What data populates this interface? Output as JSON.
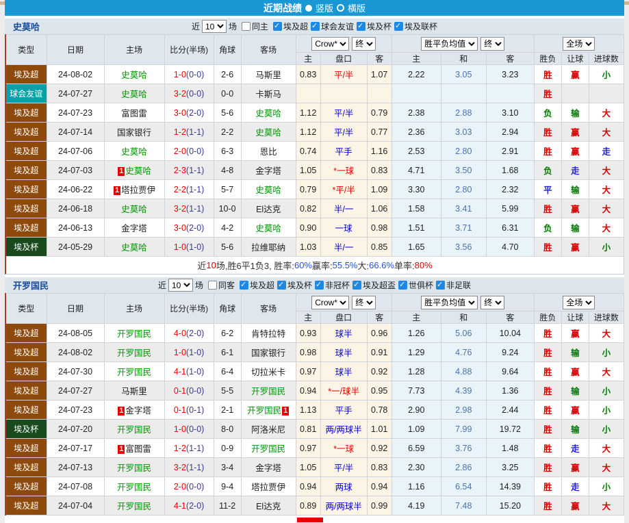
{
  "title_bar": {
    "title": "近期战绩",
    "radio_vertical": "竖版",
    "radio_horizontal": "横版"
  },
  "colors": {
    "accent_blue": "#1a97d5",
    "league_brown": "#8d4a0b",
    "friendly_teal": "#07a2a8",
    "cup_green": "#184a1d",
    "team_green": "#009900"
  },
  "card_badge": "1",
  "columns": {
    "type": "类型",
    "date": "日期",
    "home": "主场",
    "score": "比分(半场)",
    "corner": "角球",
    "away": "客场",
    "h": "主",
    "handicap": "盘口",
    "a": "客",
    "w": "主",
    "d": "和",
    "l": "客",
    "result": "胜负",
    "cover": "让球",
    "goals": "进球数",
    "odds_select": "Crow*",
    "final_select": "终",
    "avg_select": "胜平负均值",
    "scope_select": "全场"
  },
  "sections": [
    {
      "team": "史莫哈",
      "filters": {
        "near_label": "近",
        "count": "10",
        "games_label": "场",
        "same_label": "同主",
        "leagues": [
          "埃及超",
          "球会友谊",
          "埃及杯",
          "埃及联杯"
        ]
      },
      "rows": [
        {
          "lg": "埃及超",
          "lgc": "b",
          "dt": "24-08-02",
          "hm": "史莫哈",
          "hmg": true,
          "hc": false,
          "sc": "1-0",
          "hf": "(0-0)",
          "cn": "2-6",
          "aw": "马斯里",
          "awg": false,
          "ac": false,
          "o1": "0.83",
          "hd": "平/半",
          "hdr": true,
          "o2": "1.07",
          "w": "2.22",
          "d": "3.05",
          "l": "3.23",
          "rs": "胜",
          "cv": "赢",
          "gl": "小"
        },
        {
          "lg": "球会友谊",
          "lgc": "t",
          "dt": "24-07-27",
          "hm": "史莫哈",
          "hmg": true,
          "hc": false,
          "sc": "3-2",
          "hf": "(0-0)",
          "cn": "0-0",
          "aw": "卡斯马",
          "awg": false,
          "ac": false,
          "o1": "",
          "hd": "",
          "hdr": false,
          "o2": "",
          "w": "",
          "d": "",
          "l": "",
          "rs": "胜",
          "cv": "",
          "gl": ""
        },
        {
          "lg": "埃及超",
          "lgc": "b",
          "dt": "24-07-23",
          "hm": "富图雷",
          "hmg": false,
          "hc": false,
          "sc": "3-0",
          "hf": "(2-0)",
          "cn": "5-6",
          "aw": "史莫哈",
          "awg": true,
          "ac": false,
          "o1": "1.12",
          "hd": "平/半",
          "hdr": false,
          "o2": "0.79",
          "w": "2.38",
          "d": "2.88",
          "l": "3.10",
          "rs": "负",
          "cv": "输",
          "gl": "大"
        },
        {
          "lg": "埃及超",
          "lgc": "b",
          "dt": "24-07-14",
          "hm": "国家银行",
          "hmg": false,
          "hc": false,
          "sc": "1-2",
          "hf": "(1-1)",
          "cn": "2-2",
          "aw": "史莫哈",
          "awg": true,
          "ac": false,
          "o1": "1.12",
          "hd": "平/半",
          "hdr": false,
          "o2": "0.77",
          "w": "2.36",
          "d": "3.03",
          "l": "2.94",
          "rs": "胜",
          "cv": "赢",
          "gl": "大"
        },
        {
          "lg": "埃及超",
          "lgc": "b",
          "dt": "24-07-06",
          "hm": "史莫哈",
          "hmg": true,
          "hc": false,
          "sc": "2-0",
          "hf": "(0-0)",
          "cn": "6-3",
          "aw": "恩比",
          "awg": false,
          "ac": false,
          "o1": "0.74",
          "hd": "平手",
          "hdr": false,
          "o2": "1.16",
          "w": "2.53",
          "d": "2.80",
          "l": "2.91",
          "rs": "胜",
          "cv": "赢",
          "gl": "走"
        },
        {
          "lg": "埃及超",
          "lgc": "b",
          "dt": "24-07-03",
          "hm": "史莫哈",
          "hmg": true,
          "hc": true,
          "sc": "2-3",
          "hf": "(1-1)",
          "cn": "4-8",
          "aw": "金字塔",
          "awg": false,
          "ac": false,
          "o1": "1.05",
          "hd": "*一球",
          "hdr": true,
          "o2": "0.83",
          "w": "4.71",
          "d": "3.50",
          "l": "1.68",
          "rs": "负",
          "cv": "走",
          "gl": "大"
        },
        {
          "lg": "埃及超",
          "lgc": "b",
          "dt": "24-06-22",
          "hm": "塔拉贾伊",
          "hmg": false,
          "hc": true,
          "sc": "2-2",
          "hf": "(1-1)",
          "cn": "5-7",
          "aw": "史莫哈",
          "awg": true,
          "ac": false,
          "o1": "0.79",
          "hd": "*平/半",
          "hdr": true,
          "o2": "1.09",
          "w": "3.30",
          "d": "2.80",
          "l": "2.32",
          "rs": "平",
          "cv": "输",
          "gl": "大"
        },
        {
          "lg": "埃及超",
          "lgc": "b",
          "dt": "24-06-18",
          "hm": "史莫哈",
          "hmg": true,
          "hc": false,
          "sc": "3-2",
          "hf": "(1-1)",
          "cn": "10-0",
          "aw": "El达克",
          "awg": false,
          "ac": false,
          "o1": "0.82",
          "hd": "半/一",
          "hdr": false,
          "o2": "1.06",
          "w": "1.58",
          "d": "3.41",
          "l": "5.99",
          "rs": "胜",
          "cv": "赢",
          "gl": "大"
        },
        {
          "lg": "埃及超",
          "lgc": "b",
          "dt": "24-06-13",
          "hm": "金字塔",
          "hmg": false,
          "hc": false,
          "sc": "3-0",
          "hf": "(2-0)",
          "cn": "4-2",
          "aw": "史莫哈",
          "awg": true,
          "ac": false,
          "o1": "0.90",
          "hd": "一球",
          "hdr": false,
          "o2": "0.98",
          "w": "1.51",
          "d": "3.71",
          "l": "6.31",
          "rs": "负",
          "cv": "输",
          "gl": "大"
        },
        {
          "lg": "埃及杯",
          "lgc": "g",
          "dt": "24-05-29",
          "hm": "史莫哈",
          "hmg": true,
          "hc": false,
          "sc": "1-0",
          "hf": "(1-0)",
          "cn": "5-6",
          "aw": "拉维耶纳",
          "awg": false,
          "ac": false,
          "o1": "1.03",
          "hd": "半/一",
          "hdr": false,
          "o2": "0.85",
          "w": "1.65",
          "d": "3.56",
          "l": "4.70",
          "rs": "胜",
          "cv": "赢",
          "gl": "小"
        }
      ],
      "summary_parts": [
        {
          "t": "近",
          "c": "k"
        },
        {
          "t": "10",
          "c": "r"
        },
        {
          "t": "场,胜6平1负3, 胜率:",
          "c": "k"
        },
        {
          "t": "60%",
          "c": "b"
        },
        {
          "t": " 赢率:",
          "c": "k"
        },
        {
          "t": "55.5%",
          "c": "b"
        },
        {
          "t": " 大:",
          "c": "k"
        },
        {
          "t": "66.6%",
          "c": "b"
        },
        {
          "t": " 单率:",
          "c": "k"
        },
        {
          "t": "80%",
          "c": "r"
        }
      ]
    },
    {
      "team": "开罗国民",
      "filters": {
        "near_label": "近",
        "count": "10",
        "games_label": "场",
        "same_label": "同客",
        "leagues": [
          "埃及超",
          "埃及杯",
          "非冠杯",
          "埃及超盃",
          "世俱杯",
          "非足联"
        ]
      },
      "rows": [
        {
          "lg": "埃及超",
          "lgc": "b",
          "dt": "24-08-05",
          "hm": "开罗国民",
          "hmg": true,
          "hc": false,
          "sc": "4-0",
          "hf": "(2-0)",
          "cn": "6-2",
          "aw": "肯特拉特",
          "awg": false,
          "ac": false,
          "o1": "0.93",
          "hd": "球半",
          "hdr": false,
          "o2": "0.96",
          "w": "1.26",
          "d": "5.06",
          "l": "10.04",
          "rs": "胜",
          "cv": "赢",
          "gl": "大"
        },
        {
          "lg": "埃及超",
          "lgc": "b",
          "dt": "24-08-02",
          "hm": "开罗国民",
          "hmg": true,
          "hc": false,
          "sc": "1-0",
          "hf": "(1-0)",
          "cn": "6-1",
          "aw": "国家银行",
          "awg": false,
          "ac": false,
          "o1": "0.98",
          "hd": "球半",
          "hdr": false,
          "o2": "0.91",
          "w": "1.29",
          "d": "4.76",
          "l": "9.24",
          "rs": "胜",
          "cv": "输",
          "gl": "小"
        },
        {
          "lg": "埃及超",
          "lgc": "b",
          "dt": "24-07-30",
          "hm": "开罗国民",
          "hmg": true,
          "hc": false,
          "sc": "4-1",
          "hf": "(1-0)",
          "cn": "6-4",
          "aw": "切拉米卡",
          "awg": false,
          "ac": false,
          "o1": "0.97",
          "hd": "球半",
          "hdr": false,
          "o2": "0.92",
          "w": "1.28",
          "d": "4.88",
          "l": "9.64",
          "rs": "胜",
          "cv": "赢",
          "gl": "大"
        },
        {
          "lg": "埃及超",
          "lgc": "b",
          "dt": "24-07-27",
          "hm": "马斯里",
          "hmg": false,
          "hc": false,
          "sc": "0-1",
          "hf": "(0-0)",
          "cn": "5-5",
          "aw": "开罗国民",
          "awg": true,
          "ac": false,
          "o1": "0.94",
          "hd": "*一/球半",
          "hdr": true,
          "o2": "0.95",
          "w": "7.73",
          "d": "4.39",
          "l": "1.36",
          "rs": "胜",
          "cv": "输",
          "gl": "小"
        },
        {
          "lg": "埃及超",
          "lgc": "b",
          "dt": "24-07-23",
          "hm": "金字塔",
          "hmg": false,
          "hc": true,
          "sc": "0-1",
          "hf": "(0-1)",
          "cn": "2-1",
          "aw": "开罗国民",
          "awg": true,
          "ac": true,
          "o1": "1.13",
          "hd": "平手",
          "hdr": false,
          "o2": "0.78",
          "w": "2.90",
          "d": "2.98",
          "l": "2.44",
          "rs": "胜",
          "cv": "赢",
          "gl": "小"
        },
        {
          "lg": "埃及杯",
          "lgc": "g",
          "dt": "24-07-20",
          "hm": "开罗国民",
          "hmg": true,
          "hc": false,
          "sc": "1-0",
          "hf": "(0-0)",
          "cn": "8-0",
          "aw": "阿洛米尼",
          "awg": false,
          "ac": false,
          "o1": "0.81",
          "hd": "两/两球半",
          "hdr": false,
          "o2": "1.01",
          "w": "1.09",
          "d": "7.99",
          "l": "19.72",
          "rs": "胜",
          "cv": "输",
          "gl": "小"
        },
        {
          "lg": "埃及超",
          "lgc": "b",
          "dt": "24-07-17",
          "hm": "富图雷",
          "hmg": false,
          "hc": true,
          "sc": "1-2",
          "hf": "(1-1)",
          "cn": "0-9",
          "aw": "开罗国民",
          "awg": true,
          "ac": false,
          "o1": "0.97",
          "hd": "*一球",
          "hdr": true,
          "o2": "0.92",
          "w": "6.59",
          "d": "3.76",
          "l": "1.48",
          "rs": "胜",
          "cv": "走",
          "gl": "大"
        },
        {
          "lg": "埃及超",
          "lgc": "b",
          "dt": "24-07-13",
          "hm": "开罗国民",
          "hmg": true,
          "hc": false,
          "sc": "3-2",
          "hf": "(1-1)",
          "cn": "3-4",
          "aw": "金字塔",
          "awg": false,
          "ac": false,
          "o1": "1.05",
          "hd": "平/半",
          "hdr": false,
          "o2": "0.83",
          "w": "2.30",
          "d": "2.86",
          "l": "3.25",
          "rs": "胜",
          "cv": "赢",
          "gl": "大"
        },
        {
          "lg": "埃及超",
          "lgc": "b",
          "dt": "24-07-08",
          "hm": "开罗国民",
          "hmg": true,
          "hc": false,
          "sc": "2-0",
          "hf": "(0-0)",
          "cn": "9-4",
          "aw": "塔拉贾伊",
          "awg": false,
          "ac": false,
          "o1": "0.94",
          "hd": "两球",
          "hdr": false,
          "o2": "0.94",
          "w": "1.16",
          "d": "6.54",
          "l": "14.39",
          "rs": "胜",
          "cv": "走",
          "gl": "小"
        },
        {
          "lg": "埃及超",
          "lgc": "b",
          "dt": "24-07-04",
          "hm": "开罗国民",
          "hmg": true,
          "hc": false,
          "sc": "4-1",
          "hf": "(2-0)",
          "cn": "11-2",
          "aw": "El达克",
          "awg": false,
          "ac": false,
          "o1": "0.89",
          "hd": "两/两球半",
          "hdr": false,
          "o2": "0.99",
          "w": "4.19",
          "d": "7.48",
          "l": "15.20",
          "rs": "胜",
          "cv": "赢",
          "gl": "大"
        }
      ],
      "summary_parts": []
    }
  ]
}
